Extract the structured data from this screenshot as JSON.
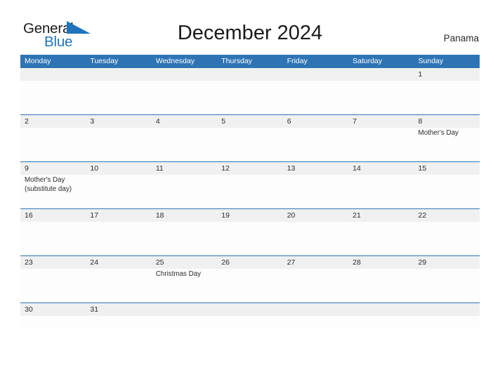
{
  "brand": {
    "name_top": "General",
    "name_bottom": "Blue",
    "flag_icon": "blue-flag-triangle",
    "accent_color": "#1f74bc"
  },
  "header": {
    "title": "December 2024",
    "country": "Panama"
  },
  "colors": {
    "header_blue": "#2e74b5",
    "number_band_gray": "#f0f0f0",
    "text": "#2b2b2b",
    "page_bg": "#ffffff"
  },
  "calendar": {
    "month": "December",
    "year": "2024",
    "weekday_headers": [
      "Monday",
      "Tuesday",
      "Wednesday",
      "Thursday",
      "Friday",
      "Saturday",
      "Sunday"
    ],
    "weeks": [
      {
        "days": [
          {
            "number": "",
            "events": []
          },
          {
            "number": "",
            "events": []
          },
          {
            "number": "",
            "events": []
          },
          {
            "number": "",
            "events": []
          },
          {
            "number": "",
            "events": []
          },
          {
            "number": "",
            "events": []
          },
          {
            "number": "1",
            "events": []
          }
        ]
      },
      {
        "days": [
          {
            "number": "2",
            "events": []
          },
          {
            "number": "3",
            "events": []
          },
          {
            "number": "4",
            "events": []
          },
          {
            "number": "5",
            "events": []
          },
          {
            "number": "6",
            "events": []
          },
          {
            "number": "7",
            "events": []
          },
          {
            "number": "8",
            "events": [
              "Mother's Day"
            ]
          }
        ]
      },
      {
        "days": [
          {
            "number": "9",
            "events": [
              "Mother's Day",
              "(substitute day)"
            ]
          },
          {
            "number": "10",
            "events": []
          },
          {
            "number": "11",
            "events": []
          },
          {
            "number": "12",
            "events": []
          },
          {
            "number": "13",
            "events": []
          },
          {
            "number": "14",
            "events": []
          },
          {
            "number": "15",
            "events": []
          }
        ]
      },
      {
        "days": [
          {
            "number": "16",
            "events": []
          },
          {
            "number": "17",
            "events": []
          },
          {
            "number": "18",
            "events": []
          },
          {
            "number": "19",
            "events": []
          },
          {
            "number": "20",
            "events": []
          },
          {
            "number": "21",
            "events": []
          },
          {
            "number": "22",
            "events": []
          }
        ]
      },
      {
        "days": [
          {
            "number": "23",
            "events": []
          },
          {
            "number": "24",
            "events": []
          },
          {
            "number": "25",
            "events": [
              "Christmas Day"
            ]
          },
          {
            "number": "26",
            "events": []
          },
          {
            "number": "27",
            "events": []
          },
          {
            "number": "28",
            "events": []
          },
          {
            "number": "29",
            "events": []
          }
        ]
      },
      {
        "days": [
          {
            "number": "30",
            "events": []
          },
          {
            "number": "31",
            "events": []
          },
          {
            "number": "",
            "events": []
          },
          {
            "number": "",
            "events": []
          },
          {
            "number": "",
            "events": []
          },
          {
            "number": "",
            "events": []
          },
          {
            "number": "",
            "events": []
          }
        ]
      }
    ]
  }
}
